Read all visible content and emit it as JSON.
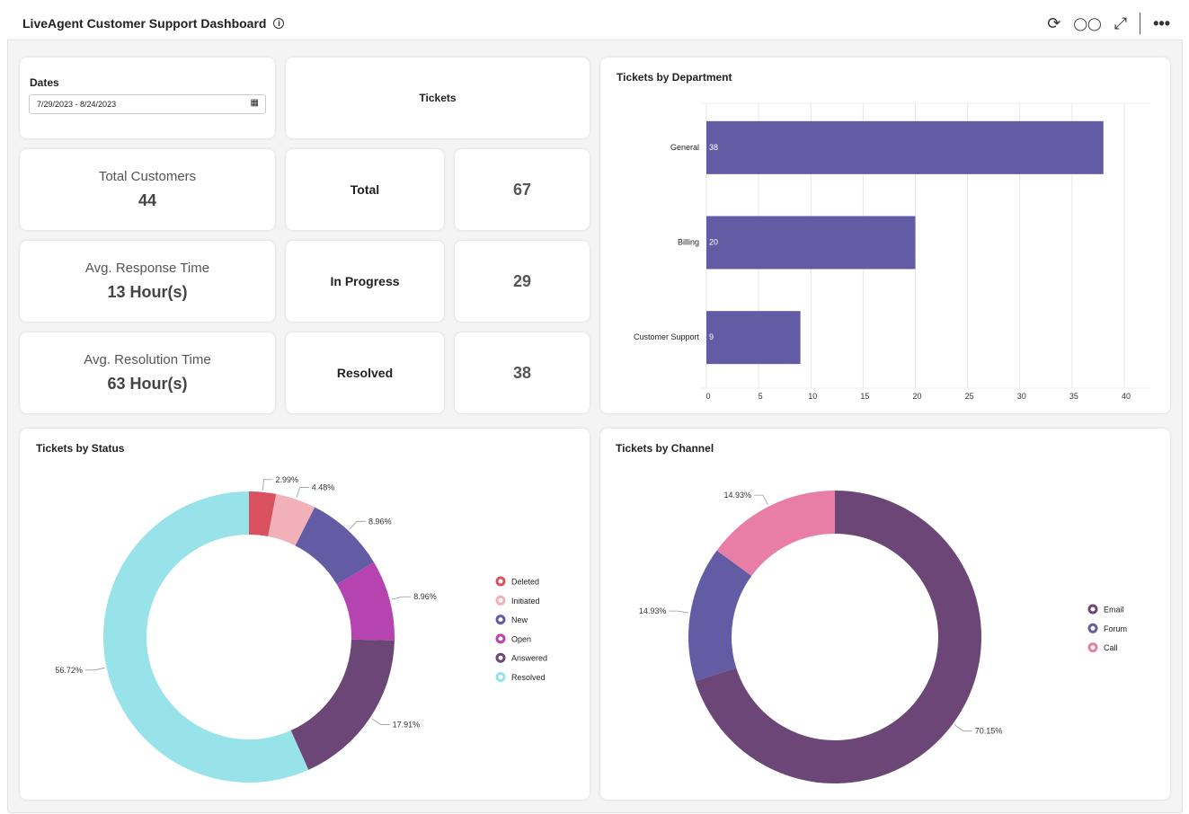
{
  "header": {
    "title": "LiveAgent Customer Support Dashboard",
    "icons": [
      "info-icon",
      "refresh-icon",
      "glasses-icon",
      "expand-icon",
      "more-icon"
    ]
  },
  "dates": {
    "label": "Dates",
    "value": "7/29/2023 - 8/24/2023"
  },
  "tickets_header": "Tickets",
  "kpis": [
    {
      "label": "Total Customers",
      "value": "44"
    },
    {
      "label": "Avg. Response Time",
      "value": "13 Hour(s)"
    },
    {
      "label": "Avg. Resolution Time",
      "value": "63 Hour(s)"
    }
  ],
  "ticket_counts": [
    {
      "label": "Total",
      "value": "67"
    },
    {
      "label": "In Progress",
      "value": "29"
    },
    {
      "label": "Resolved",
      "value": "38"
    }
  ],
  "chart_data": [
    {
      "type": "bar",
      "orientation": "horizontal",
      "title": "Tickets by Department",
      "categories": [
        "General",
        "Billing",
        "Customer Support"
      ],
      "values": [
        38,
        20,
        9
      ],
      "xlim": [
        0,
        40
      ],
      "xticks": [
        0,
        5,
        10,
        15,
        20,
        25,
        30,
        35,
        40
      ],
      "color": "#635ca5",
      "grid": true
    },
    {
      "type": "pie",
      "donut": true,
      "title": "Tickets by Status",
      "categories": [
        "Deleted",
        "Initiated",
        "New",
        "Open",
        "Answered",
        "Resolved"
      ],
      "values": [
        2.99,
        4.48,
        8.96,
        8.96,
        17.91,
        56.72
      ],
      "labels": [
        "2.99%",
        "4.48%",
        "8.96%",
        "8.96%",
        "17.91%",
        "56.72%"
      ],
      "colors": [
        "#d9505f",
        "#f2b0b9",
        "#635ca5",
        "#b544b0",
        "#6b4677",
        "#98e2ea"
      ],
      "legend": "right"
    },
    {
      "type": "pie",
      "donut": true,
      "title": "Tickets by Channel",
      "categories": [
        "Email",
        "Forum",
        "Call"
      ],
      "values": [
        70.15,
        14.93,
        14.93
      ],
      "labels": [
        "70.15%",
        "14.93%",
        "14.93%"
      ],
      "colors": [
        "#6b4677",
        "#635ca5",
        "#e87ea6"
      ],
      "legend": "right"
    }
  ]
}
